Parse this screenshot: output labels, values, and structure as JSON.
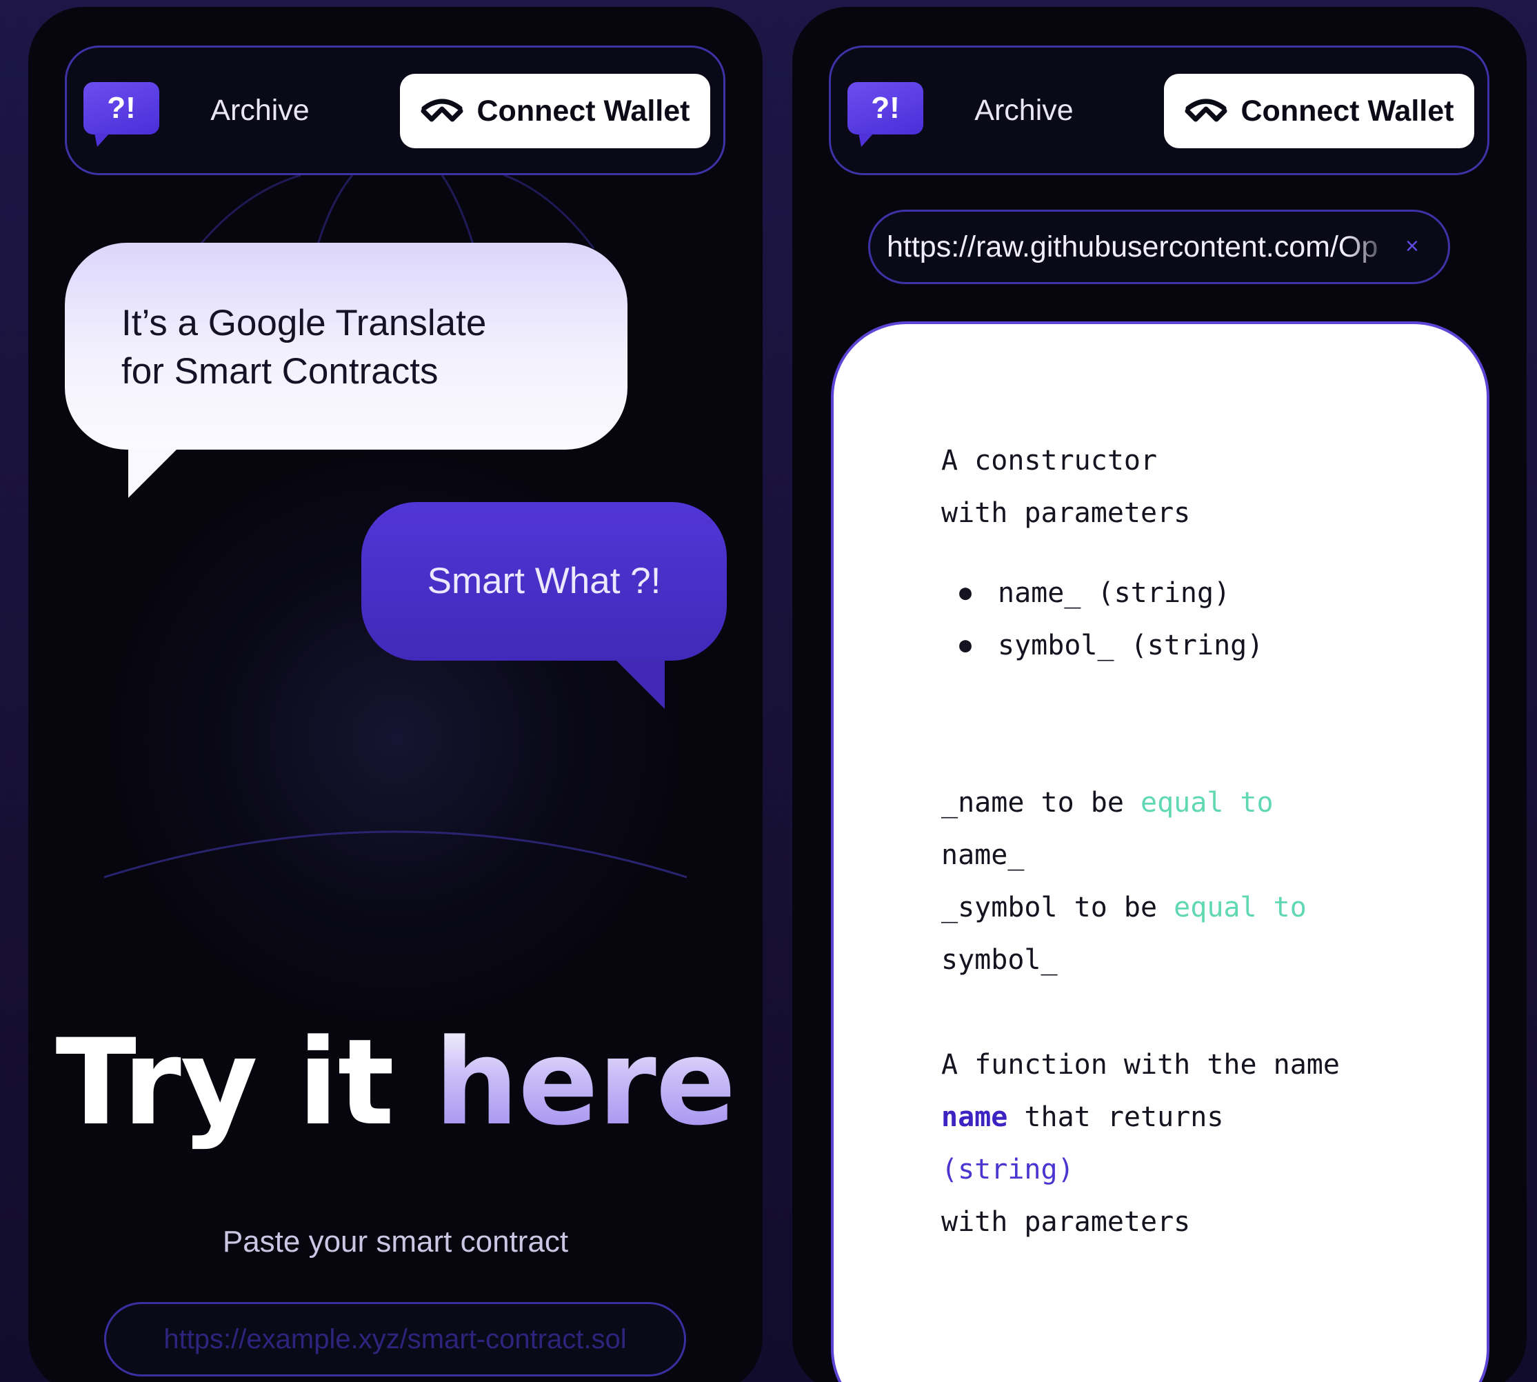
{
  "left": {
    "nav": {
      "logo": "?!",
      "archive": "Archive",
      "connect": "Connect Wallet"
    },
    "bubble_white": {
      "line1": "It’s a Google Translate",
      "line2": "for Smart Contracts"
    },
    "bubble_purple": "Smart What ?!",
    "hero": {
      "part1": "Try it ",
      "part2": "here"
    },
    "subtitle": "Paste your smart contract",
    "input": {
      "placeholder": "https://example.xyz/smart-contract.sol",
      "value": ""
    }
  },
  "right": {
    "nav": {
      "logo": "?!",
      "archive": "Archive",
      "connect": "Connect Wallet"
    },
    "url": {
      "value": "https://raw.githubusercontent.com/Op",
      "clear": "×"
    },
    "code": {
      "l1": "A constructor",
      "l2": "with parameters",
      "b1": "name_ (string)",
      "b2": "symbol_ (string)",
      "a1": "_name to be ",
      "a1k": "equal to",
      "a2": "name_",
      "a3": "_symbol to be ",
      "a3k": "equal to",
      "a4": "symbol_",
      "f1": "A function with the name",
      "f2k": "name",
      "f2": " that returns",
      "f3k": "(string)",
      "f4": "with parameters"
    }
  },
  "colors": {
    "accent": "#5136d6",
    "border": "#3d32a6",
    "highlight": "#5fd8b3"
  }
}
